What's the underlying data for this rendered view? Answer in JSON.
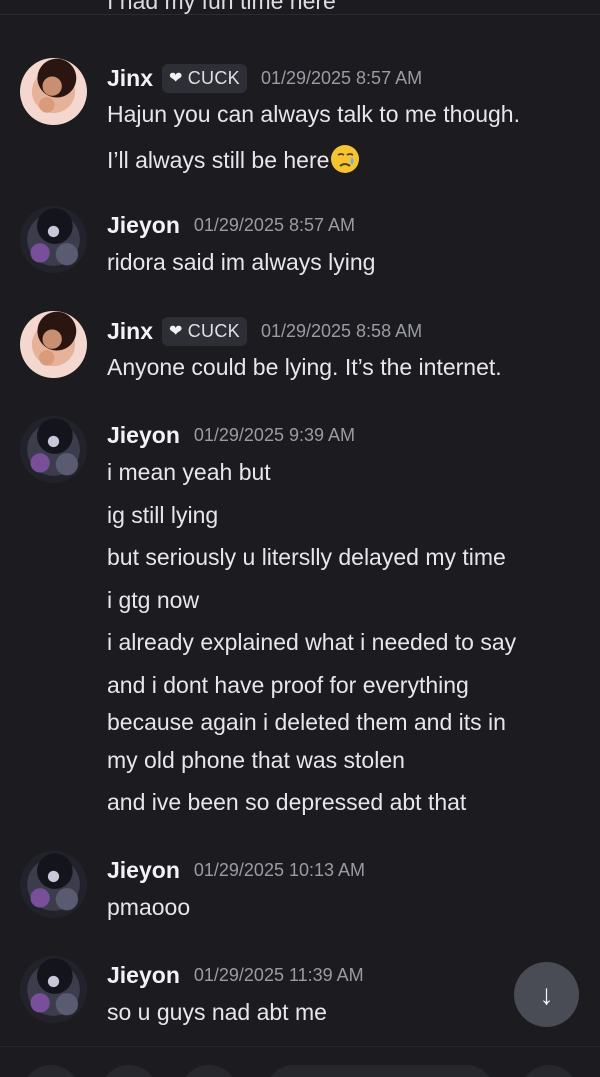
{
  "cutoff_text": "I had my fun time here",
  "messages": [
    {
      "user": "Jinx",
      "avatar": "jinx-avatar",
      "tag": {
        "icon": "heart-icon",
        "label": "CUCK"
      },
      "time": "01/29/2025 8:57 AM",
      "lines": [
        "Hajun you can always talk to me though.",
        "I’ll always still be here"
      ],
      "emoji": "crying-face-emoji"
    },
    {
      "user": "Jieyon",
      "avatar": "jieyon-avatar",
      "time": "01/29/2025 8:57 AM",
      "lines": [
        "ridora said im always lying"
      ]
    },
    {
      "user": "Jinx",
      "avatar": "jinx-avatar",
      "tag": {
        "icon": "heart-icon",
        "label": "CUCK"
      },
      "time": "01/29/2025 8:58 AM",
      "lines": [
        "Anyone could be lying. It’s the internet."
      ]
    },
    {
      "user": "Jieyon",
      "avatar": "jieyon-avatar",
      "time": "01/29/2025 9:39 AM",
      "lines": [
        "i mean yeah but",
        "ig still lying",
        "but seriously u literslly delayed my time",
        "i gtg now",
        "i already explained what i needed to say",
        "and i dont have proof for everything",
        "because again i deleted them and its in",
        "my old phone that was stolen",
        "and ive been so depressed abt that"
      ]
    },
    {
      "user": "Jieyon",
      "avatar": "jieyon-avatar",
      "time": "01/29/2025 10:13 AM",
      "lines": [
        "pmaooo"
      ]
    },
    {
      "user": "Jieyon",
      "avatar": "jieyon-avatar",
      "time": "01/29/2025 11:39 AM",
      "lines": [
        "so u guys nad abt me"
      ]
    }
  ],
  "scroll_button": {
    "icon": "arrow-down-icon",
    "glyph": "↓"
  }
}
